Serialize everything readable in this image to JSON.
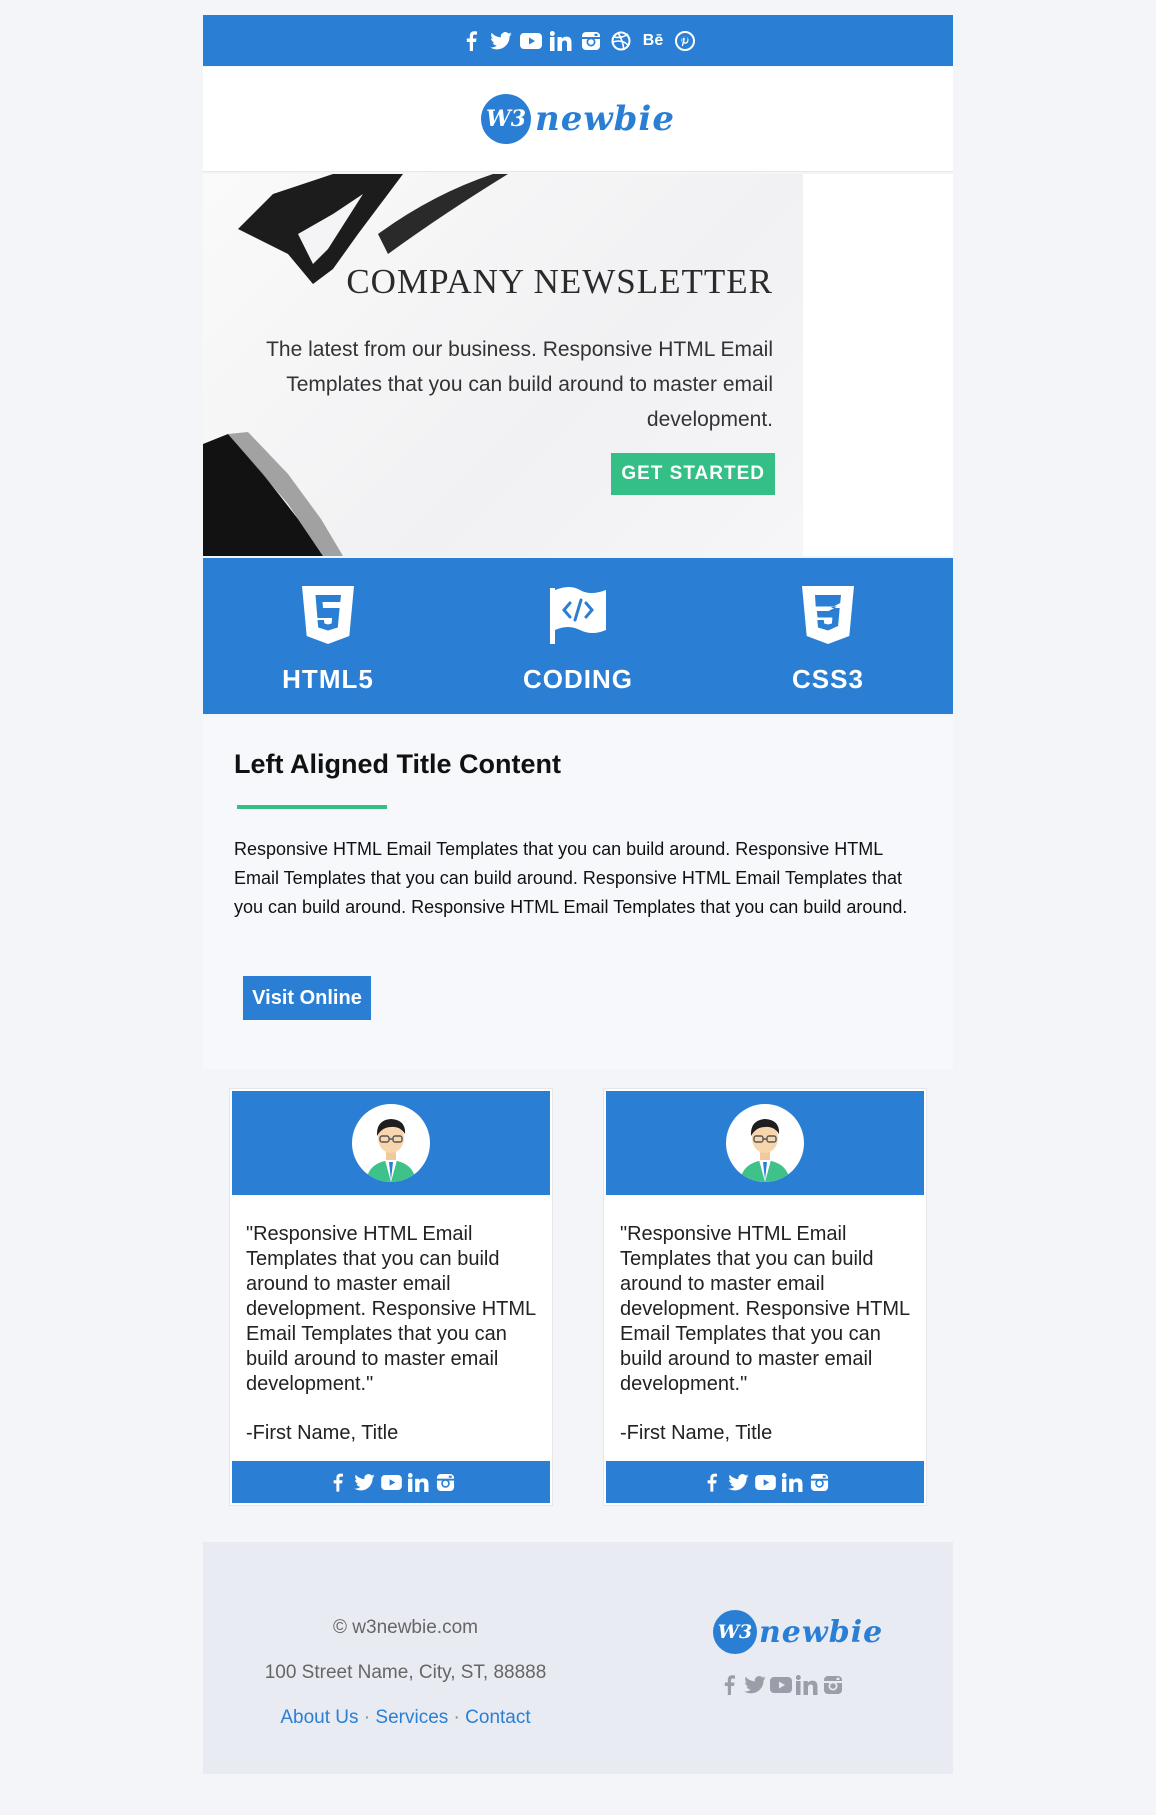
{
  "brand": {
    "logo_mark": "W3",
    "logo_text": "newbie",
    "primary_color": "#2a7fd4",
    "accent_color": "#34bf86"
  },
  "top_social": [
    "facebook-icon",
    "twitter-icon",
    "youtube-icon",
    "linkedin-icon",
    "instagram-icon",
    "dribbble-icon",
    "behance-icon",
    "pinterest-icon"
  ],
  "top_social_behance_label": "Bē",
  "hero": {
    "title": "COMPANY NEWSLETTER",
    "text": "The latest from our business. Responsive HTML Email Templates that you can build around to master email development.",
    "button": "GET STARTED"
  },
  "features": [
    {
      "label": "HTML5",
      "icon": "html5-icon"
    },
    {
      "label": "CODING",
      "icon": "coding-flag-icon"
    },
    {
      "label": "CSS3",
      "icon": "css3-icon"
    }
  ],
  "content": {
    "title": "Left Aligned Title Content",
    "body": "Responsive HTML Email Templates that you can build around. Responsive HTML Email Templates that you can build around. Responsive HTML Email Templates that you can build around. Responsive HTML Email Templates that you can build around.",
    "button": "Visit Online"
  },
  "testimonials": [
    {
      "quote": "\"Responsive HTML Email Templates that you can build around to master email development. Responsive HTML Email Templates that you can build around to master email development.\"",
      "author": "-First Name, Title"
    },
    {
      "quote": "\"Responsive HTML Email Templates that you can build around to master email development. Responsive HTML Email Templates that you can build around to master email development.\"",
      "author": "-First Name, Title"
    }
  ],
  "footer": {
    "copyright": "© w3newbie.com",
    "address": "100 Street Name, City, ST, 88888",
    "links": [
      "About Us",
      "Services",
      "Contact"
    ],
    "separator": "·"
  }
}
